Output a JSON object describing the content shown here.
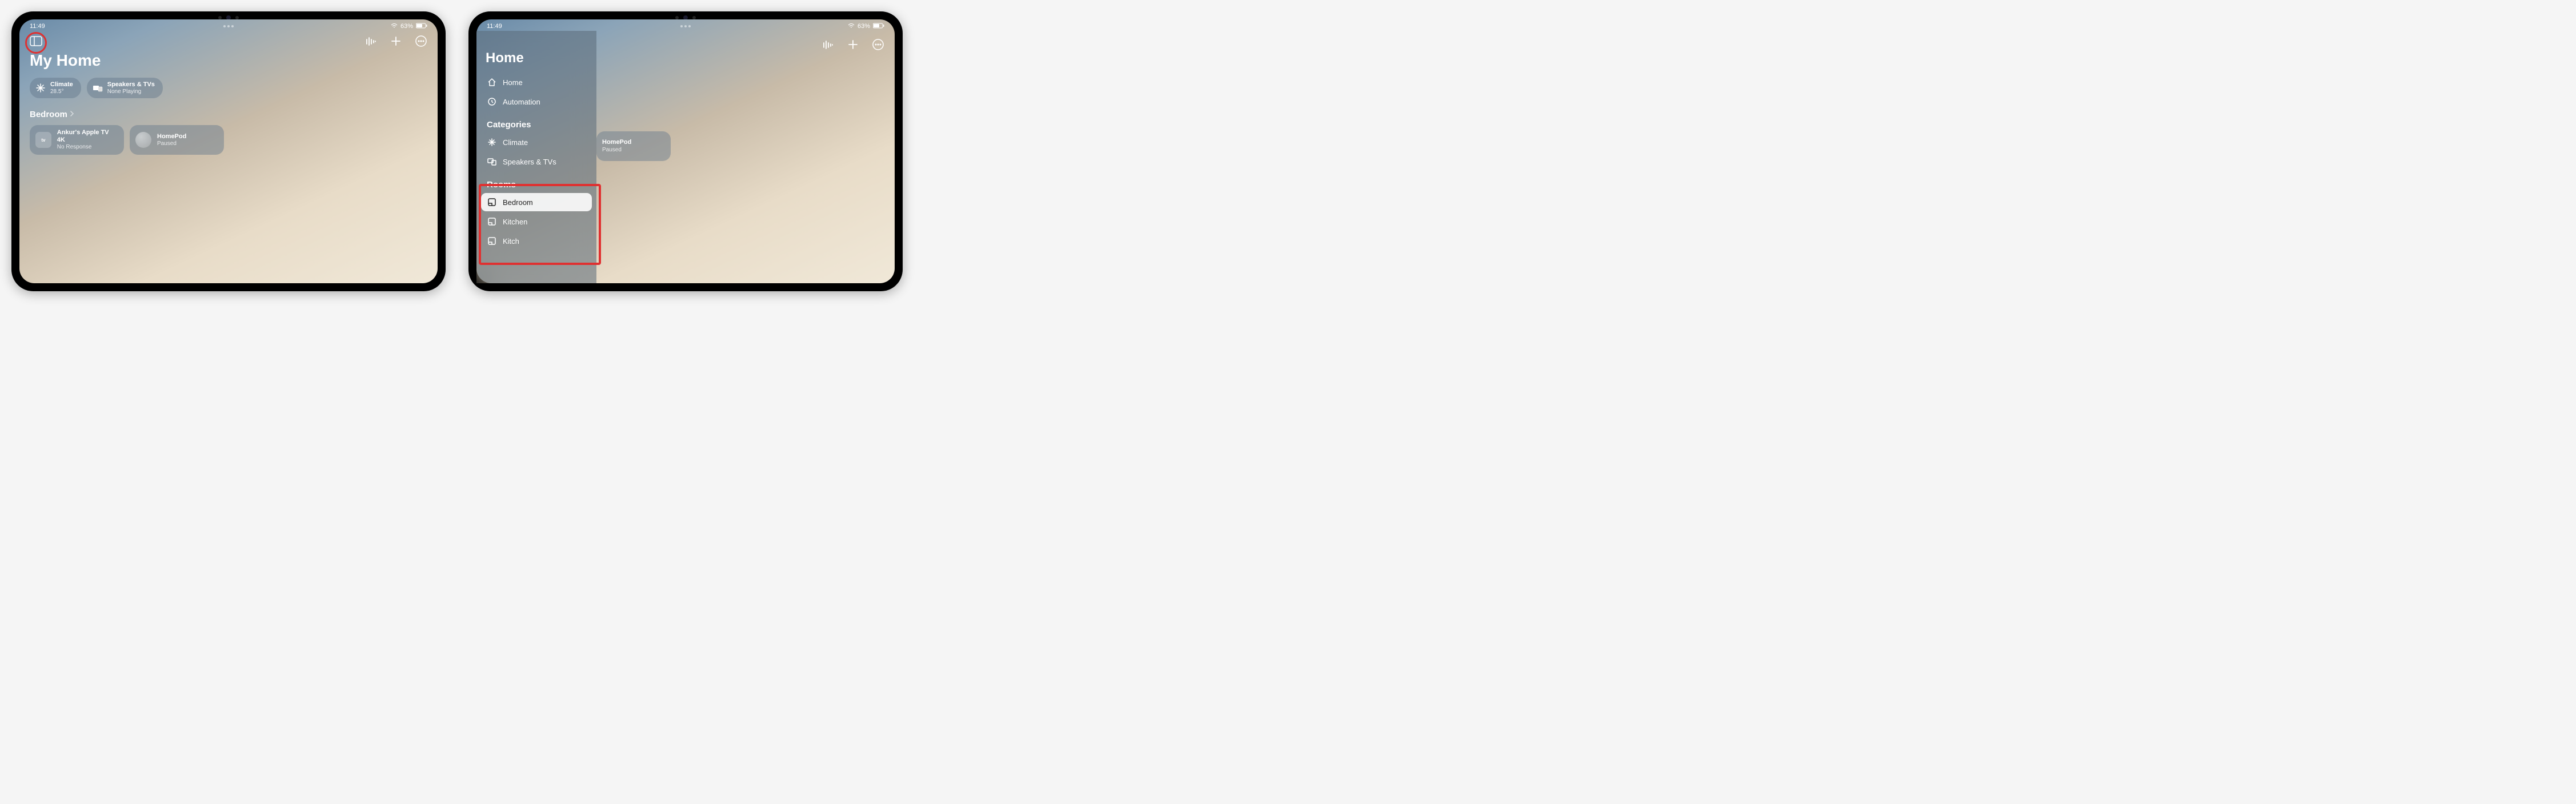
{
  "status": {
    "time": "11:49",
    "battery_pct": "63%"
  },
  "screen1": {
    "page_title": "My Home",
    "chips": [
      {
        "title": "Climate",
        "sub": "28.5°",
        "icon": "climate"
      },
      {
        "title": "Speakers & TVs",
        "sub": "None Playing",
        "icon": "speakers"
      }
    ],
    "section": {
      "label": "Bedroom"
    },
    "tiles": [
      {
        "title": "Ankur's Apple TV 4K",
        "sub": "No Response",
        "icon": "atv"
      },
      {
        "title": "HomePod",
        "sub": "Paused",
        "icon": "homepod"
      }
    ]
  },
  "screen2": {
    "sidebar_title": "Home",
    "nav": [
      {
        "label": "Home",
        "icon": "home"
      },
      {
        "label": "Automation",
        "icon": "automation"
      }
    ],
    "categories_label": "Categories",
    "categories": [
      {
        "label": "Climate",
        "icon": "climate"
      },
      {
        "label": "Speakers & TVs",
        "icon": "speakers"
      }
    ],
    "rooms_label": "Rooms",
    "rooms": [
      {
        "label": "Bedroom",
        "selected": true
      },
      {
        "label": "Kitchen",
        "selected": false
      },
      {
        "label": "Kitch",
        "selected": false
      }
    ],
    "floating_tile": {
      "title": "HomePod",
      "sub": "Paused"
    }
  }
}
